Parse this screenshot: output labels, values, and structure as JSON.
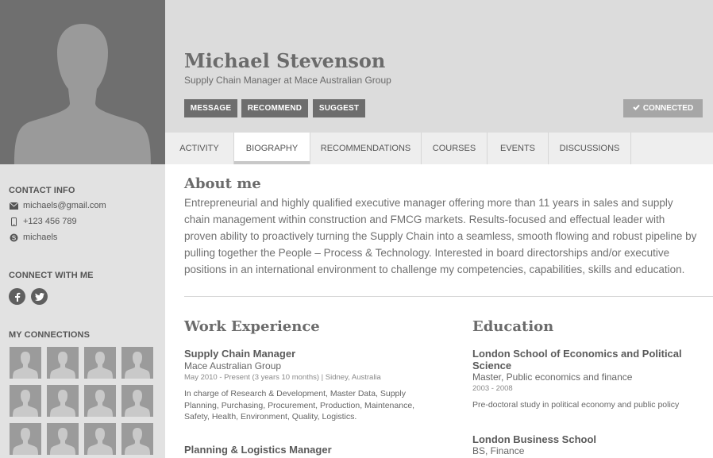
{
  "profile": {
    "name": "Michael Stevenson",
    "headline": "Supply Chain Manager at Mace Australian Group"
  },
  "actions": {
    "message": "MESSAGE",
    "recommend": "RECOMMEND",
    "suggest": "SUGGEST",
    "connected": "CONNECTED"
  },
  "tabs": [
    {
      "label": "ACTIVITY",
      "active": false
    },
    {
      "label": "BIOGRAPHY",
      "active": true
    },
    {
      "label": "RECOMMENDATIONS",
      "active": false
    },
    {
      "label": "COURSES",
      "active": false
    },
    {
      "label": "EVENTS",
      "active": false
    },
    {
      "label": "DISCUSSIONS",
      "active": false
    }
  ],
  "sidebar": {
    "contact_heading": "CONTACT INFO",
    "email": "michaels@gmail.com",
    "phone": "+123 456 789",
    "skype": "michaels",
    "connect_heading": "CONNECT WITH ME",
    "connections_heading": "MY CONNECTIONS",
    "social_icons": [
      "facebook-icon",
      "twitter-icon"
    ]
  },
  "about": {
    "title": "About me",
    "text": "Entrepreneurial and highly qualified executive manager offering more than 11 years in sales and supply chain management within construction and FMCG markets. Results-focused and effectual leader with proven ability to proactively turning the Supply Chain into a seamless, smooth flowing and robust pipeline by pulling together the People – Process & Technology. Interested in board directorships and/or executive positions in an international environment to challenge my competencies, capabilities, skills and education."
  },
  "work": {
    "title": "Work Experience",
    "jobs": [
      {
        "title": "Supply Chain Manager",
        "company": "Mace Australian Group",
        "meta": "May 2010 - Present (3 years 10 months) | Sidney, Australia",
        "description": "In charge of Research & Development, Master Data, Supply Planning, Purchasing, Procurement, Production, Maintenance, Safety, Health, Environment, Quality, Logistics."
      },
      {
        "title": "Planning & Logistics Manager"
      }
    ]
  },
  "education": {
    "title": "Education",
    "schools": [
      {
        "name": "London School of Economics and Political Science",
        "degree": "Master, Public economics and finance",
        "years": "2003 - 2008",
        "description": "Pre-doctoral study in political economy and public policy"
      },
      {
        "name": "London Business School",
        "degree": "BS, Finance"
      }
    ]
  },
  "colors": {
    "sidebar_bg": "#e2e2e2",
    "header_bg": "#dcdcdc",
    "button_bg": "#6d6d6d",
    "connected_bg": "#a6a6a6"
  }
}
